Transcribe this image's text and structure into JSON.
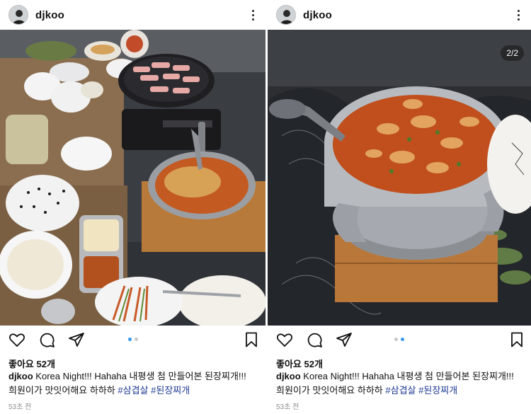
{
  "posts": [
    {
      "username": "djkoo",
      "likes": "좋아요 52개",
      "caption_user": "djkoo",
      "caption_text": "Korea Night!!! Hahaha 내평생 첨 만들어본 된장찌개!!!",
      "caption_line2": "희원이가 맛잇어해요 하하하",
      "hashtags": [
        "#삼겹살",
        "#된장찌개"
      ],
      "time": "53초 전",
      "image": "Korean barbecue table with pork belly on grill and doenjang-jjigae stew",
      "carousel_index": 1,
      "carousel_total": 2
    },
    {
      "username": "djkoo",
      "counter": "2/2",
      "likes": "좋아요 52개",
      "caption_user": "djkoo",
      "caption_text": "Korea Night!!! Hahaha 내평생 첨 만들어본 된장찌개!!!",
      "caption_line2": "희원이가 맛잇어해요 하하하",
      "hashtags": [
        "#삼겹살",
        "#된장찌개"
      ],
      "time": "53초 전",
      "image": "Close-up of doenjang-jjigae stew pot with ladle on wooden board",
      "carousel_index": 2,
      "carousel_total": 2
    }
  ],
  "icons": [
    "heart-icon",
    "comment-icon",
    "share-icon",
    "bookmark-icon",
    "more-icon"
  ],
  "colors": {
    "dot_active": "#3897f0",
    "hashtag": "#1f3a93",
    "timestamp": "#8e8e8e"
  }
}
